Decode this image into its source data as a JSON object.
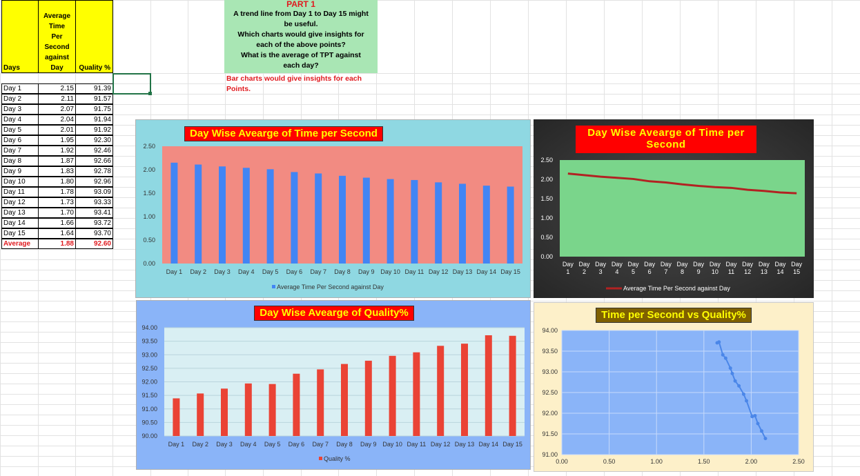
{
  "table": {
    "headers": {
      "days": "Days",
      "tpt": "Average Time Per Second against Day",
      "tpt_lines": [
        "Average",
        "Time",
        "Per",
        "Second",
        "against",
        "Day"
      ],
      "quality": "Quality %"
    },
    "rows": [
      {
        "day": "Day 1",
        "tpt": "2.15",
        "quality": "91.39"
      },
      {
        "day": "Day 2",
        "tpt": "2.11",
        "quality": "91.57"
      },
      {
        "day": "Day 3",
        "tpt": "2.07",
        "quality": "91.75"
      },
      {
        "day": "Day 4",
        "tpt": "2.04",
        "quality": "91.94"
      },
      {
        "day": "Day 5",
        "tpt": "2.01",
        "quality": "91.92"
      },
      {
        "day": "Day 6",
        "tpt": "1.95",
        "quality": "92.30"
      },
      {
        "day": "Day 7",
        "tpt": "1.92",
        "quality": "92.46"
      },
      {
        "day": "Day 8",
        "tpt": "1.87",
        "quality": "92.66"
      },
      {
        "day": "Day 9",
        "tpt": "1.83",
        "quality": "92.78"
      },
      {
        "day": "Day 10",
        "tpt": "1.80",
        "quality": "92.96"
      },
      {
        "day": "Day 11",
        "tpt": "1.78",
        "quality": "93.09"
      },
      {
        "day": "Day 12",
        "tpt": "1.73",
        "quality": "93.33"
      },
      {
        "day": "Day 13",
        "tpt": "1.70",
        "quality": "93.41"
      },
      {
        "day": "Day 14",
        "tpt": "1.66",
        "quality": "93.72"
      },
      {
        "day": "Day 15",
        "tpt": "1.64",
        "quality": "93.70"
      }
    ],
    "average": {
      "label": "Average",
      "tpt": "1.88",
      "quality": "92.60"
    }
  },
  "notes": {
    "part_title": "PART 1",
    "question_lines": [
      "A trend line from Day 1 to Day 15 might",
      "be useful.",
      "Which charts would give insights for",
      "each of the above points?",
      "What is the average of TPT against",
      "each day?"
    ],
    "answer_lines": [
      "Bar charts would give insights for each",
      "Points."
    ]
  },
  "colors": {
    "header_yellow": "#ffff00",
    "note_green": "#a9e6b4",
    "answer_red": "#e0191e",
    "chart1_bg": "#8fd8e2",
    "chart1_plot": "#f28b82",
    "chart1_bar": "#4285f4",
    "chart2_bg": "#333333",
    "chart2_plot": "#7ad58b",
    "chart2_line": "#b22222",
    "chart3_bg": "#8ab4f8",
    "chart3_plot": "#d9eff3",
    "chart3_bar": "#ea4335",
    "chart4_bg": "#fdf0c9",
    "chart4_plot": "#8ab4f8",
    "chart4_line": "#4a86e8",
    "title_red": "#ff0000",
    "title_yellow": "#ffff00",
    "title_olive": "#7f6000"
  },
  "chart_data": [
    {
      "type": "bar",
      "title": "Day Wise Avearge of Time per Second",
      "categories": [
        "Day 1",
        "Day 2",
        "Day 3",
        "Day 4",
        "Day 5",
        "Day 6",
        "Day 7",
        "Day 8",
        "Day 9",
        "Day 10",
        "Day 11",
        "Day 12",
        "Day 13",
        "Day 14",
        "Day 15"
      ],
      "series": [
        {
          "name": "Average Time Per Second against Day",
          "values": [
            2.15,
            2.11,
            2.07,
            2.04,
            2.01,
            1.95,
            1.92,
            1.87,
            1.83,
            1.8,
            1.78,
            1.73,
            1.7,
            1.66,
            1.64
          ]
        }
      ],
      "ylim": [
        0,
        2.5
      ],
      "yticks": [
        "0.00",
        "0.50",
        "1.00",
        "1.50",
        "2.00",
        "2.50"
      ],
      "legend": "bottom"
    },
    {
      "type": "line",
      "title": "Day Wise Avearge of Time per Second",
      "categories": [
        "Day 1",
        "Day 2",
        "Day 3",
        "Day 4",
        "Day 5",
        "Day 6",
        "Day 7",
        "Day 8",
        "Day 9",
        "Day 10",
        "Day 11",
        "Day 12",
        "Day 13",
        "Day 14",
        "Day 15"
      ],
      "series": [
        {
          "name": "Average Time Per Second against Day",
          "values": [
            2.15,
            2.11,
            2.07,
            2.04,
            2.01,
            1.95,
            1.92,
            1.87,
            1.83,
            1.8,
            1.78,
            1.73,
            1.7,
            1.66,
            1.64
          ]
        }
      ],
      "ylim": [
        0,
        2.5
      ],
      "yticks": [
        "0.00",
        "0.50",
        "1.00",
        "1.50",
        "2.00",
        "2.50"
      ],
      "legend": "bottom"
    },
    {
      "type": "bar",
      "title": "Day Wise Avearge of Quality%",
      "categories": [
        "Day 1",
        "Day 2",
        "Day 3",
        "Day 4",
        "Day 5",
        "Day 6",
        "Day 7",
        "Day 8",
        "Day 9",
        "Day 10",
        "Day 11",
        "Day 12",
        "Day 13",
        "Day 14",
        "Day 15"
      ],
      "series": [
        {
          "name": "Quality %",
          "values": [
            91.39,
            91.57,
            91.75,
            91.94,
            91.92,
            92.3,
            92.46,
            92.66,
            92.78,
            92.96,
            93.09,
            93.33,
            93.41,
            93.72,
            93.7
          ]
        }
      ],
      "ylim": [
        90,
        94
      ],
      "yticks": [
        "90.00",
        "90.50",
        "91.00",
        "91.50",
        "92.00",
        "92.50",
        "93.00",
        "93.50",
        "94.00"
      ],
      "legend": "bottom"
    },
    {
      "type": "scatter",
      "title": "Time per Second vs Quality%",
      "x": [
        2.15,
        2.11,
        2.07,
        2.04,
        2.01,
        1.95,
        1.92,
        1.87,
        1.83,
        1.8,
        1.78,
        1.73,
        1.7,
        1.66,
        1.64
      ],
      "y": [
        91.39,
        91.57,
        91.75,
        91.94,
        91.92,
        92.3,
        92.46,
        92.66,
        92.78,
        92.96,
        93.09,
        93.33,
        93.41,
        93.72,
        93.7
      ],
      "xlim": [
        0,
        2.5
      ],
      "ylim": [
        91,
        94
      ],
      "xticks": [
        "0.00",
        "0.50",
        "1.00",
        "1.50",
        "2.00",
        "2.50"
      ],
      "yticks": [
        "91.00",
        "91.50",
        "92.00",
        "92.50",
        "93.00",
        "93.50",
        "94.00"
      ]
    }
  ]
}
